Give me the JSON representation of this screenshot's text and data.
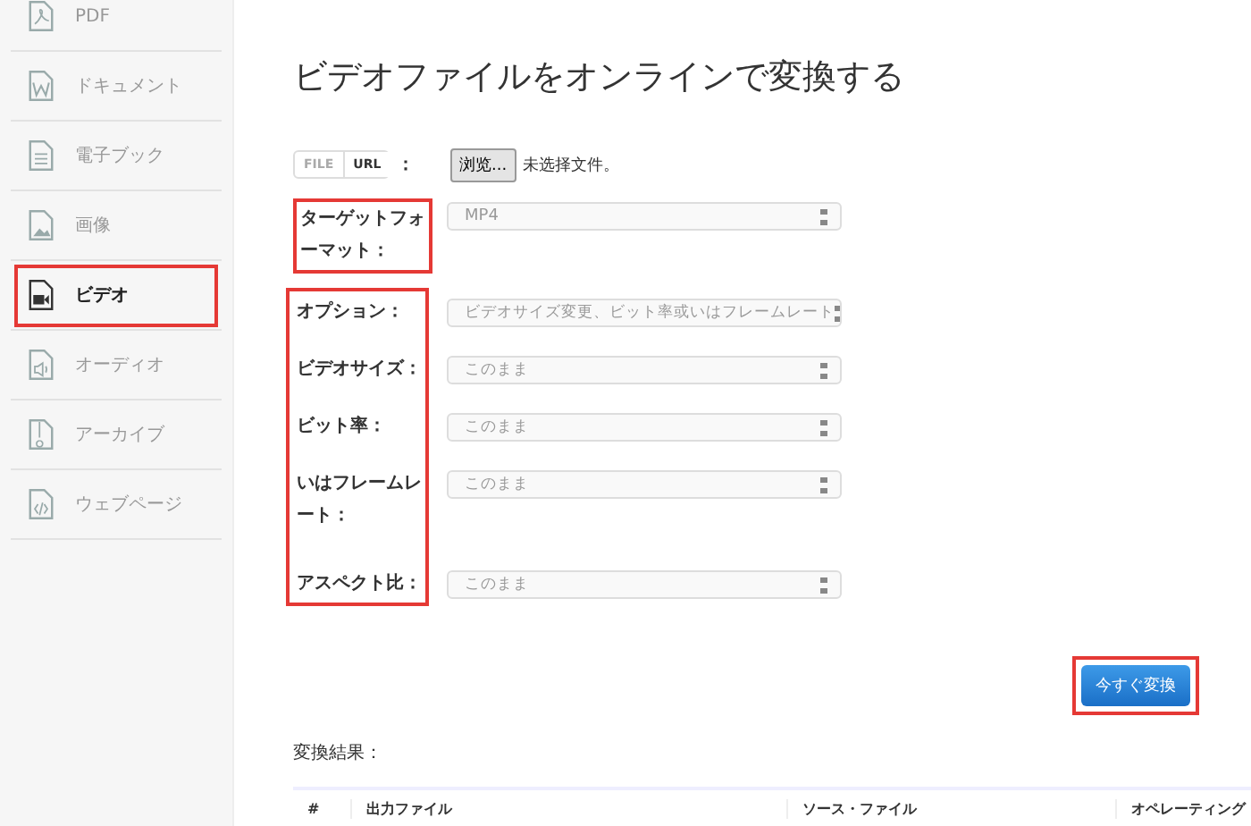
{
  "sidebar": {
    "items": [
      {
        "label": "PDF",
        "kind": "pdf",
        "selected": false,
        "highlighted": false
      },
      {
        "label": "ドキュメント",
        "kind": "word",
        "selected": false,
        "highlighted": false
      },
      {
        "label": "電子ブック",
        "kind": "text",
        "selected": false,
        "highlighted": false
      },
      {
        "label": "画像",
        "kind": "image",
        "selected": false,
        "highlighted": false
      },
      {
        "label": "ビデオ",
        "kind": "video",
        "selected": true,
        "highlighted": true
      },
      {
        "label": "オーディオ",
        "kind": "audio",
        "selected": false,
        "highlighted": false
      },
      {
        "label": "アーカイブ",
        "kind": "archive",
        "selected": false,
        "highlighted": false
      },
      {
        "label": "ウェブページ",
        "kind": "code",
        "selected": false,
        "highlighted": false
      }
    ]
  },
  "title": "ビデオファイルをオンラインで変換する",
  "source": {
    "tabs": [
      {
        "label": "FILE",
        "selected": false
      },
      {
        "label": "URL",
        "selected": true
      }
    ],
    "colon": "：",
    "browse_button": "浏览...",
    "file_status": "未选择文件。"
  },
  "target_format": {
    "label": "ターゲットフォーマット：",
    "value": "MP4",
    "highlighted": true
  },
  "options_group": {
    "highlighted": true,
    "rows": [
      {
        "label": "オプション：",
        "value": "ビデオサイズ変更、ビット率或いはフレームレート"
      },
      {
        "label": "ビデオサイズ：",
        "value": "このまま"
      },
      {
        "label": "ビット率：",
        "value": "このまま"
      },
      {
        "label": "いはフレームレート：",
        "value": "このまま"
      },
      {
        "label": "アスペクト比：",
        "value": "このまま"
      }
    ]
  },
  "convert_button": {
    "label": "今すぐ変換",
    "highlighted": true
  },
  "results": {
    "label": "変換結果：",
    "columns": [
      "#",
      "出力ファイル",
      "ソース・ファイル",
      "オペレーティング"
    ]
  }
}
